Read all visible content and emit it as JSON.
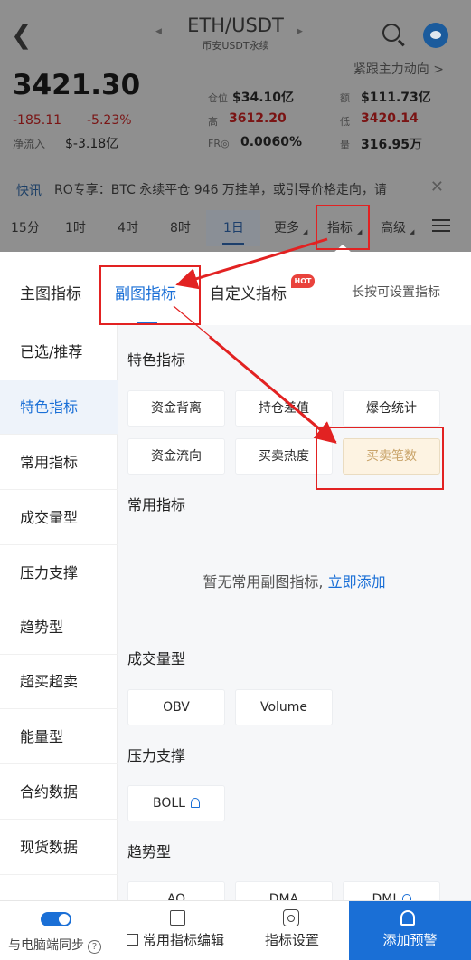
{
  "header": {
    "pair": "ETH/USDT",
    "subtitle": "币安USDT永续",
    "follow_link": "紧跟主力动向 >"
  },
  "ticker": {
    "last_price": "3421.30",
    "change": "-185.11",
    "change_pct": "-5.23%",
    "inflow_label": "净流入",
    "inflow_value": "$-3.18亿",
    "stats": [
      {
        "label": "仓位",
        "value": "$34.10亿"
      },
      {
        "label": "额",
        "value": "$111.73亿"
      },
      {
        "label": "高",
        "value": "3612.20"
      },
      {
        "label": "低",
        "value": "3420.14"
      },
      {
        "label": "FR◎",
        "value": "0.0060%"
      },
      {
        "label": "量",
        "value": "316.95万"
      }
    ]
  },
  "news": {
    "tag": "快讯",
    "text": "RO专享：BTC 永续平仓 946 万挂单，或引导价格走向，请",
    "close": "✕"
  },
  "timeframes": [
    "15分",
    "1时",
    "4时",
    "8时",
    "1日",
    "更多",
    "指标",
    "高级"
  ],
  "panel": {
    "tabs": [
      "主图指标",
      "副图指标",
      "自定义指标"
    ],
    "hot_badge": "HOT",
    "hint": "长按可设置指标",
    "nav": [
      "已选/推荐",
      "特色指标",
      "常用指标",
      "成交量型",
      "压力支撑",
      "趋势型",
      "超买超卖",
      "能量型",
      "合约数据",
      "现货数据"
    ],
    "sections": {
      "featured_title": "特色指标",
      "featured": [
        "资金背离",
        "持仓差值",
        "爆仓统计",
        "资金流向",
        "买卖热度",
        "买卖笔数"
      ],
      "common_title": "常用指标",
      "empty_text": "暂无常用副图指标,",
      "empty_link": "立即添加",
      "volume_title": "成交量型",
      "volume": [
        "OBV",
        "Volume"
      ],
      "support_title": "压力支撑",
      "support": [
        "BOLL"
      ],
      "trend_title": "趋势型",
      "trend": [
        "AO",
        "DMA",
        "DMI"
      ]
    }
  },
  "bottom_bar": {
    "sync_label": "与电脑端同步",
    "help": "?",
    "edit_label": "常用指标编辑",
    "settings_label": "指标设置",
    "alert_label": "添加预警"
  },
  "colors": {
    "accent": "#1a6fd6",
    "annotation": "#e22222",
    "highlight_bg": "#fdf3e2"
  }
}
